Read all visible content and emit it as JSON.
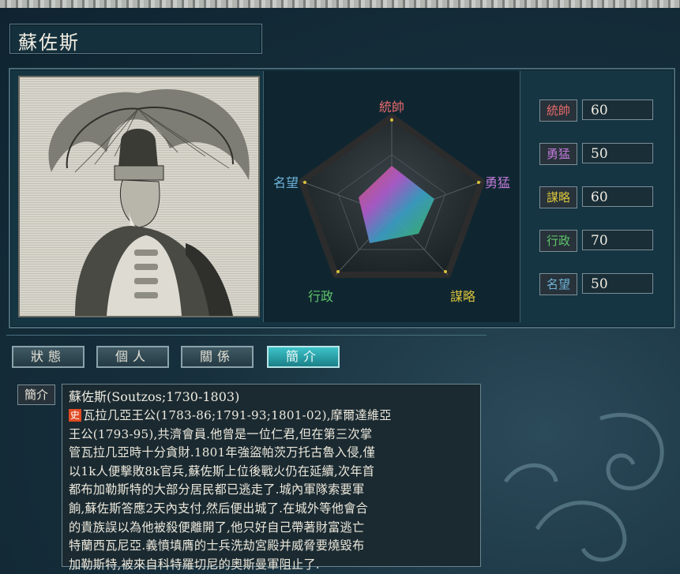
{
  "character": {
    "name": "蘇佐斯"
  },
  "radar": {
    "labels": [
      "統帥",
      "勇猛",
      "謀略",
      "行政",
      "名望"
    ],
    "label_colors": [
      "#e86b6b",
      "#c07ad8",
      "#d8c23a",
      "#5fc46a",
      "#6fb3d8"
    ]
  },
  "stats": [
    {
      "label": "統帥",
      "value": "60",
      "color": "#e86b6b"
    },
    {
      "label": "勇猛",
      "value": "50",
      "color": "#c07ad8"
    },
    {
      "label": "謀略",
      "value": "60",
      "color": "#d8c23a"
    },
    {
      "label": "行政",
      "value": "70",
      "color": "#5fc46a"
    },
    {
      "label": "名望",
      "value": "50",
      "color": "#6fb3d8"
    }
  ],
  "tabs": [
    {
      "label": "狀態"
    },
    {
      "label": "個人"
    },
    {
      "label": "關係"
    },
    {
      "label": "簡介"
    }
  ],
  "bio": {
    "side_label": "簡介",
    "title": "蘇佐斯(Soutzos;1730-1803)",
    "tag": "史",
    "lines": [
      "瓦拉几亞王公(1783-86;1791-93;1801-02),摩爾達維亞",
      "王公(1793-95),共濟會員.他曾是一位仁君,但在第三次掌",
      "管瓦拉几亞時十分貪財.1801年強盜帕茨万托古魯入侵,僅",
      "以1k人便擊敗8k官兵,蘇佐斯上位後戰火仍在延續,次年首",
      "都布加勒斯特的大部分居民都已逃走了.城內軍隊索要軍",
      "餉,蘇佐斯答應2天內支付,然后便出城了.在城外等他會合",
      "的貴族誤以為他被殺便離開了,他只好自己帶著財富逃亡",
      "特蘭西瓦尼亞.義憤填膺的士兵洗劫宮殿并威脅要燒毀布",
      "加勒斯特,被來自科特羅切尼的奧斯曼軍阻止了."
    ]
  }
}
